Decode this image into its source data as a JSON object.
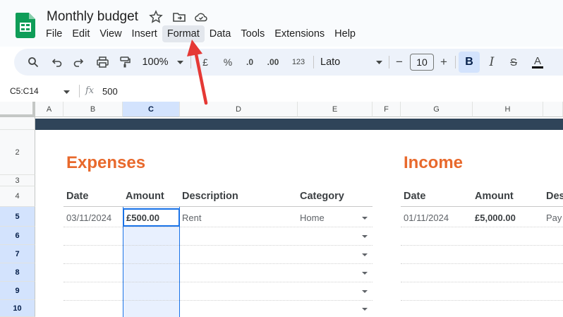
{
  "document": {
    "title": "Monthly budget"
  },
  "menu": [
    "File",
    "Edit",
    "View",
    "Insert",
    "Format",
    "Data",
    "Tools",
    "Extensions",
    "Help"
  ],
  "active_menu": "Format",
  "toolbar": {
    "zoom": "100%",
    "currency": "£",
    "percent": "%",
    "decrease_decimals": ".0",
    "increase_decimals": ".00",
    "number_format": "123",
    "font": "Lato",
    "font_size": "10",
    "minus": "−",
    "plus": "+",
    "bold": "B",
    "italic": "I",
    "strikethrough": "S",
    "text_color": "A"
  },
  "formula_bar": {
    "name_box": "C5:C14",
    "fx": "fx",
    "value": "500"
  },
  "columns": [
    "A",
    "B",
    "C",
    "D",
    "E",
    "F",
    "G",
    "H"
  ],
  "rows": [
    "2",
    "3",
    "4",
    "5",
    "6",
    "7",
    "8",
    "9",
    "10"
  ],
  "expenses": {
    "title": "Expenses",
    "headers": {
      "date": "Date",
      "amount": "Amount",
      "description": "Description",
      "category": "Category"
    },
    "row1": {
      "date": "03/11/2024",
      "amount": "£500.00",
      "description": "Rent",
      "category": "Home"
    }
  },
  "income": {
    "title": "Income",
    "headers": {
      "date": "Date",
      "amount": "Amount",
      "description": "Des"
    },
    "row1": {
      "date": "01/11/2024",
      "amount": "£5,000.00",
      "description": "Pay"
    }
  },
  "colors": {
    "accent": "#e8692c",
    "banner": "#2f4459",
    "selection": "#1a73e8",
    "annotation": "#e53935"
  }
}
